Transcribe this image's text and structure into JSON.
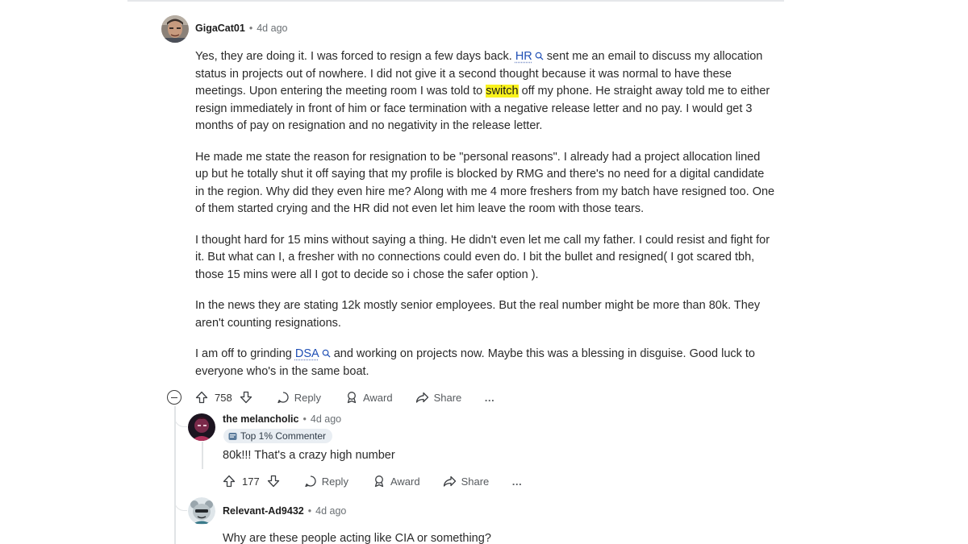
{
  "comment": {
    "username": "GigaCat01",
    "time": "4d ago",
    "paragraphs": [
      [
        "Yes, they are doing it. I was forced to resign a few days back. ",
        "HR",
        " sent me an email to discuss my allocation status in projects out of nowhere. I did not give it a second thought because it was normal to have these meetings. Upon entering the meeting room I was told to ",
        "switch",
        " off my phone. He straight away told me to either resign immediately in front of him or face termination with a negative release letter and no pay. I would get 3 months of pay on resignation and no negativity in the release letter."
      ],
      "He made me state the reason for resignation to be \"personal reasons\". I already had a project allocation lined up but he totally shut it off saying that my profile is blocked by RMG and there's no need for a digital candidate in the region. Why did they even hire me? Along with me 4 more freshers from my batch have resigned too. One of them started crying and the HR did not even let him leave the room with those tears.",
      "I thought hard for 15 mins without saying a thing. He didn't even let me call my father. I could resist and fight for it. But what can I, a fresher with no connections could even do. I bit the bullet and resigned( I got scared tbh, those 15 mins were all I got to decide so i chose the safer option ).",
      "In the news they are stating 12k mostly senior employees. But the real number might be more than 80k. They aren't counting resignations.",
      [
        "I am off to grinding ",
        "DSA",
        " and working on projects now. Maybe this was a blessing in disguise. Good luck to everyone who's in the same boat."
      ]
    ],
    "score": "758",
    "reply_label": "Reply",
    "award_label": "Award",
    "share_label": "Share",
    "more_label": "…"
  },
  "reply1": {
    "username": "the melancholic",
    "time": "4d ago",
    "badge": "Top 1% Commenter",
    "text": "80k!!! That's a crazy high number",
    "score": "177",
    "reply_label": "Reply",
    "award_label": "Award",
    "share_label": "Share",
    "more_label": "…"
  },
  "reply2": {
    "username": "Relevant-Ad9432",
    "time": "4d ago",
    "text": "Why are these people acting like CIA or something?"
  },
  "dot": "•",
  "colors": {
    "link": "#1f4fb5",
    "highlight": "#f9f21d",
    "thread": "#e1e4e6",
    "badge_bg": "#e9eef3"
  }
}
